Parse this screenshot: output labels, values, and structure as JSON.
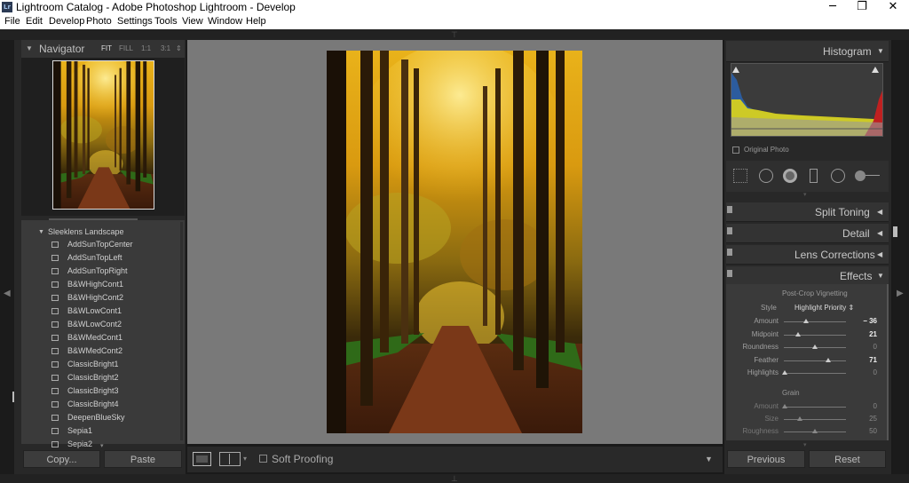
{
  "window": {
    "title": "Lightroom Catalog - Adobe Photoshop Lightroom - Develop",
    "logo_text": "Lr",
    "minimize": "─",
    "restore": "❐",
    "close": "✕"
  },
  "menu": [
    "File",
    "Edit",
    "Develop",
    "Photo",
    "Settings",
    "Tools",
    "View",
    "Window",
    "Help"
  ],
  "navigator": {
    "title": "Navigator",
    "zoom": [
      "FIT",
      "FILL",
      "1:1",
      "3:1"
    ],
    "zoom_spin": "⇕"
  },
  "presets": {
    "folder": "Sleeklens Landscape",
    "items": [
      "AddSunTopCenter",
      "AddSunTopLeft",
      "AddSunTopRight",
      "B&WHighCont1",
      "B&WHighCont2",
      "B&WLowCont1",
      "B&WLowCont2",
      "B&WMedCont1",
      "B&WMedCont2",
      "ClassicBright1",
      "ClassicBright2",
      "ClassicBright3",
      "ClassicBright4",
      "DeepenBlueSky",
      "Sepia1",
      "Sepia2"
    ]
  },
  "left_buttons": {
    "copy": "Copy...",
    "paste": "Paste"
  },
  "toolbar": {
    "soft_proofing": "Soft Proofing"
  },
  "histogram": {
    "title": "Histogram",
    "original_photo": "Original Photo"
  },
  "panels": {
    "split_toning": "Split Toning",
    "detail": "Detail",
    "lens_corrections": "Lens Corrections",
    "effects": "Effects"
  },
  "effects": {
    "vignette_title": "Post-Crop Vignetting",
    "style_label": "Style",
    "style_value": "Highlight Priority ⇕",
    "sliders": [
      {
        "label": "Amount",
        "value": "− 36",
        "pos": 0.36,
        "bright": true
      },
      {
        "label": "Midpoint",
        "value": "21",
        "pos": 0.23,
        "bright": true
      },
      {
        "label": "Roundness",
        "value": "0",
        "pos": 0.5,
        "bright": false
      },
      {
        "label": "Feather",
        "value": "71",
        "pos": 0.71,
        "bright": true
      },
      {
        "label": "Highlights",
        "value": "0",
        "pos": 0.02,
        "bright": false
      }
    ],
    "grain_title": "Grain",
    "grain_sliders": [
      {
        "label": "Amount",
        "value": "0",
        "pos": 0.02
      },
      {
        "label": "Size",
        "value": "25",
        "pos": 0.25
      },
      {
        "label": "Roughness",
        "value": "50",
        "pos": 0.5
      }
    ]
  },
  "right_buttons": {
    "previous": "Previous",
    "reset": "Reset"
  },
  "colors": {
    "panel_bg": "#282828",
    "canvas_bg": "#797979",
    "text": "#c8c8c8"
  }
}
